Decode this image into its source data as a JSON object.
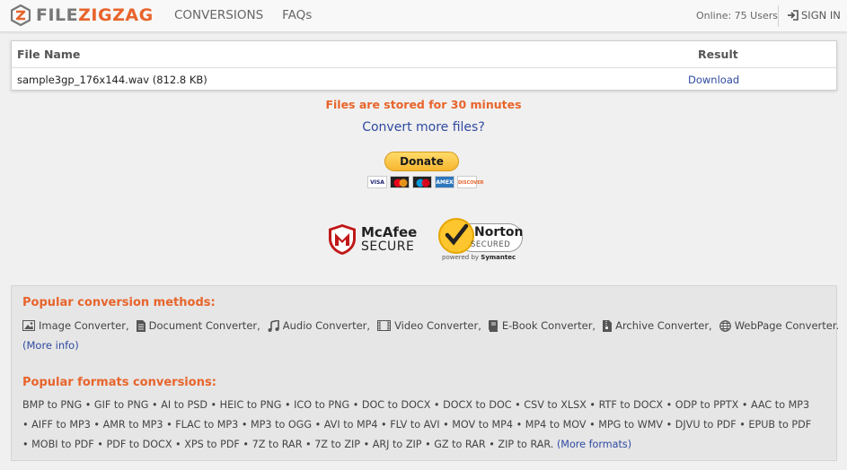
{
  "header": {
    "logo": {
      "part1": "FILE",
      "part2": "ZIGZAG",
      "icon": "zigzag-logo-icon"
    },
    "nav": [
      "CONVERSIONS",
      "FAQs"
    ],
    "online": "Online: 75 Users",
    "signin": "SIGN IN",
    "signin_icon": "sign-in-icon"
  },
  "table": {
    "headers": {
      "file_name": "File Name",
      "result": "Result"
    },
    "row": {
      "file": "sample3gp_176x144.wav (812.8 KB)",
      "action": "Download"
    }
  },
  "status": {
    "stored": "Files are stored for 30 minutes",
    "convert_more": "Convert more files?"
  },
  "donate": {
    "label": "Donate",
    "cards": [
      "VISA",
      "MC",
      "MAESTRO",
      "AMEX",
      "DISCOVER"
    ]
  },
  "trust": {
    "mcafee": {
      "name": "McAfee",
      "secure": "SECURE"
    },
    "norton": {
      "name": "Norton",
      "secured": "SECURED",
      "powered": "powered by",
      "symantec": "Symantec"
    }
  },
  "popular": {
    "methods_heading": "Popular conversion methods:",
    "methods": [
      {
        "label": "Image Converter,",
        "icon": "image-icon"
      },
      {
        "label": "Document Converter,",
        "icon": "document-icon"
      },
      {
        "label": "Audio Converter,",
        "icon": "music-icon"
      },
      {
        "label": "Video Converter,",
        "icon": "film-icon"
      },
      {
        "label": "E-Book Converter,",
        "icon": "book-icon"
      },
      {
        "label": "Archive Converter,",
        "icon": "archive-icon"
      },
      {
        "label": "WebPage Converter.",
        "icon": "globe-icon"
      }
    ],
    "more_info": "(More info)",
    "formats_heading": "Popular formats conversions:",
    "formats": [
      "BMP to PNG",
      "GIF to PNG",
      "AI to PSD",
      "HEIC to PNG",
      "ICO to PNG",
      "DOC to DOCX",
      "DOCX to DOC",
      "CSV to XLSX",
      "RTF to DOCX",
      "ODP to PPTX",
      "AAC to MP3",
      "AIFF to MP3",
      "AMR to MP3",
      "FLAC to MP3",
      "MP3 to OGG",
      "AVI to MP4",
      "FLV to AVI",
      "MOV to MP4",
      "MP4 to MOV",
      "MPG to WMV",
      "DJVU to PDF",
      "EPUB to PDF",
      "MOBI to PDF",
      "PDF to DOCX",
      "XPS to PDF",
      "7Z to RAR",
      "7Z to ZIP",
      "ARJ to ZIP",
      "GZ to RAR",
      "ZIP to RAR."
    ],
    "more_formats": "(More formats)"
  }
}
